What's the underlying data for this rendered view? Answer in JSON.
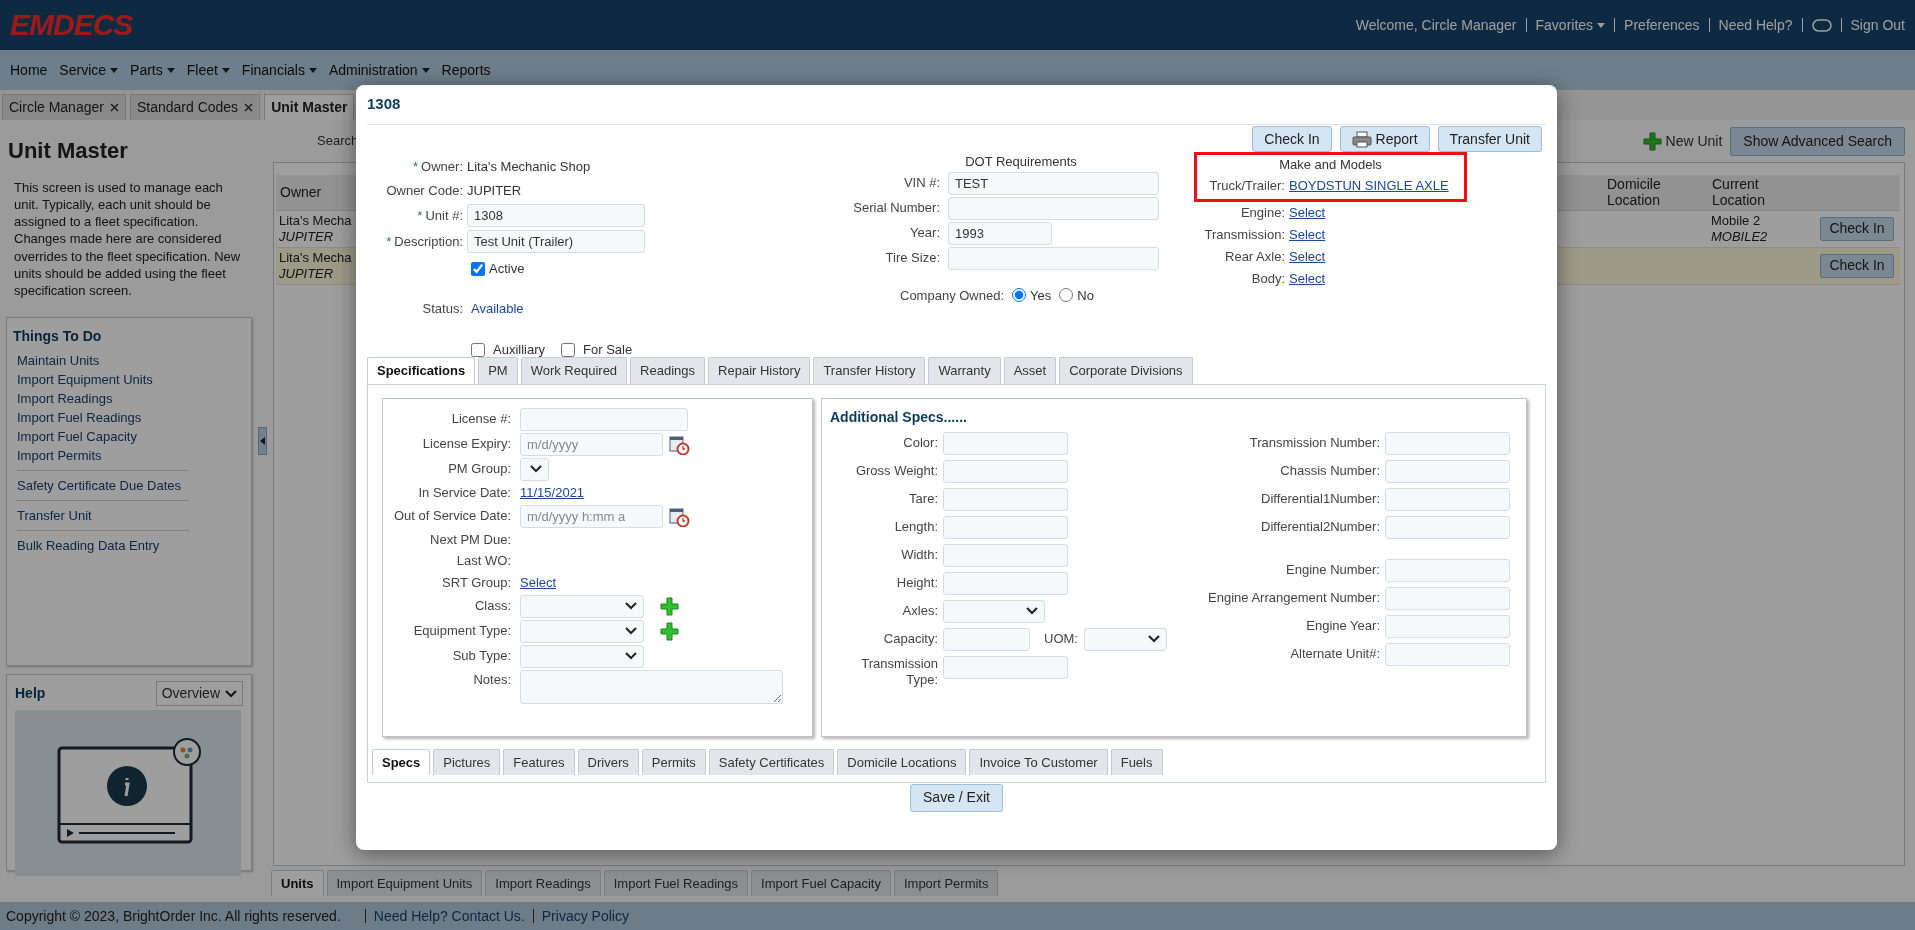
{
  "app": {
    "logo": "EMDECS"
  },
  "header_links": [
    {
      "kind": "text",
      "label": "Welcome, Circle Manager"
    },
    {
      "kind": "menu",
      "label": "Favorites"
    },
    {
      "kind": "link",
      "label": "Preferences"
    },
    {
      "kind": "link",
      "label": "Need Help?"
    },
    {
      "kind": "toggle"
    },
    {
      "kind": "link",
      "label": "Sign Out"
    }
  ],
  "menu": [
    {
      "label": "Home",
      "dropdown": false
    },
    {
      "label": "Service",
      "dropdown": true
    },
    {
      "label": "Parts",
      "dropdown": true
    },
    {
      "label": "Fleet",
      "dropdown": true
    },
    {
      "label": "Financials",
      "dropdown": true
    },
    {
      "label": "Administration",
      "dropdown": true
    },
    {
      "label": "Reports",
      "dropdown": false
    }
  ],
  "page_tabs": [
    {
      "label": "Circle Manager",
      "closable": true,
      "selected": false
    },
    {
      "label": "Standard Codes",
      "closable": true,
      "selected": false
    },
    {
      "label": "Unit Master",
      "closable": false,
      "selected": true
    }
  ],
  "sidebar": {
    "title": "Unit Master",
    "description": "This screen is used to manage each unit. Typically, each unit should be assigned to a fleet specification. Changes made here are considered overrides to the fleet specification. New units should be added using the fleet specification screen.",
    "todo": {
      "title": "Things To Do",
      "groups": [
        [
          "Maintain Units",
          "Import Equipment Units",
          "Import Readings",
          "Import Fuel Readings",
          "Import Fuel Capacity",
          "Import Permits"
        ],
        [
          "Safety Certificate Due Dates"
        ],
        [
          "Transfer Unit"
        ],
        [
          "Bulk Reading Data Entry"
        ]
      ]
    },
    "help": {
      "title": "Help",
      "dropdown": "Overview"
    }
  },
  "main": {
    "search_label": "Search",
    "new_unit": "New Unit",
    "advanced_search": "Show Advanced Search",
    "table": {
      "columns": [
        "Owner",
        "Domicile Location",
        "Current Location"
      ],
      "rows": [
        {
          "owner": "Lita's Mecha",
          "owner_code": "JUPITER",
          "location": "Mobile 2",
          "location_code": "MOBILE2",
          "action": "Check In",
          "selected": false
        },
        {
          "owner": "Lita's Mecha",
          "owner_code": "JUPITER",
          "action": "Check In",
          "selected": true
        }
      ]
    },
    "bottom_tabs": [
      {
        "label": "Units",
        "selected": true
      },
      {
        "label": "Import Equipment Units",
        "selected": false
      },
      {
        "label": "Import Readings",
        "selected": false
      },
      {
        "label": "Import Fuel Readings",
        "selected": false
      },
      {
        "label": "Import Fuel Capacity",
        "selected": false
      },
      {
        "label": "Import Permits",
        "selected": false
      }
    ]
  },
  "modal": {
    "title": "1308",
    "actions": [
      {
        "kind": "plain",
        "label": "Check In"
      },
      {
        "kind": "with-icon",
        "label": "Report"
      },
      {
        "kind": "plain",
        "label": "Transfer Unit"
      }
    ],
    "general": [
      {
        "marker": "*",
        "label": "Owner:",
        "kind": "static",
        "value": "Lita's Mechanic Shop"
      },
      {
        "label": "Owner Code:",
        "kind": "static",
        "value": "JUPITER"
      },
      {
        "marker": "*",
        "label": "Unit #:",
        "kind": "input",
        "value": "1308"
      },
      {
        "marker": "*",
        "label": "Description:",
        "kind": "input",
        "value": "Test Unit (Trailer)"
      }
    ],
    "active": {
      "label": "Active",
      "checked": true
    },
    "status": {
      "label": "Status:",
      "value": "Available"
    },
    "flags": [
      {
        "label": "Auxilliary",
        "checked": false
      },
      {
        "label": "For Sale",
        "checked": false
      }
    ],
    "dot": {
      "title": "DOT Requirements",
      "fields": [
        {
          "kind": "long",
          "label": "VIN #:",
          "value": "TEST"
        },
        {
          "kind": "long",
          "label": "Serial Number:"
        },
        {
          "kind": "short",
          "label": "Year:",
          "value": "1993"
        },
        {
          "kind": "long",
          "label": "Tire Size:"
        }
      ],
      "company_owned": {
        "label": "Company Owned:",
        "options": [
          {
            "label": "Yes",
            "selected": true
          },
          {
            "label": "No",
            "selected": false
          }
        ]
      }
    },
    "make_models": {
      "title": "Make and Models",
      "highlighted": true,
      "rows": [
        {
          "label": "Truck/Trailer:",
          "value": "BOYDSTUN SINGLE AXLE"
        },
        {
          "label": "Engine:",
          "value": "Select"
        },
        {
          "label": "Transmission:",
          "value": "Select"
        },
        {
          "label": "Rear Axle:",
          "value": "Select"
        },
        {
          "label": "Body:",
          "value": "Select"
        }
      ]
    },
    "tabs": [
      {
        "label": "Specifications",
        "selected": true
      },
      {
        "label": "PM",
        "selected": false
      },
      {
        "label": "Work Required",
        "selected": false
      },
      {
        "label": "Readings",
        "selected": false
      },
      {
        "label": "Repair History",
        "selected": false
      },
      {
        "label": "Transfer History",
        "selected": false
      },
      {
        "label": "Warranty",
        "selected": false
      },
      {
        "label": "Asset",
        "selected": false
      },
      {
        "label": "Corporate Divisions",
        "selected": false
      }
    ],
    "spec_fields": [
      {
        "label": "License #:",
        "kind": "input"
      },
      {
        "label": "License Expiry:",
        "kind": "date",
        "placeholder": "m/d/yyyy"
      },
      {
        "label": "PM Group:",
        "kind": "select-small"
      },
      {
        "label": "In Service Date:",
        "kind": "link",
        "value": "11/15/2021"
      },
      {
        "label": "Out of Service Date:",
        "kind": "date",
        "placeholder": "m/d/yyyy h:mm a"
      },
      {
        "label": "Next PM Due:",
        "kind": "static"
      },
      {
        "label": "Last WO:",
        "kind": "static"
      },
      {
        "label": "SRT Group:",
        "kind": "link",
        "value": "Select"
      },
      {
        "label": "Class:",
        "kind": "select",
        "add": true
      },
      {
        "label": "Equipment Type:",
        "kind": "select",
        "add": true
      },
      {
        "label": "Sub Type:",
        "kind": "select",
        "add": false
      },
      {
        "label": "Notes:",
        "kind": "textarea"
      }
    ],
    "additional": {
      "title": "Additional Specs......",
      "left": [
        {
          "label": "Color:",
          "kind": "input"
        },
        {
          "label": "Gross Weight:",
          "kind": "input"
        },
        {
          "label": "Tare:",
          "kind": "input"
        },
        {
          "label": "Length:",
          "kind": "input"
        },
        {
          "label": "Width:",
          "kind": "input"
        },
        {
          "label": "Height:",
          "kind": "input"
        },
        {
          "label": "Axles:",
          "kind": "select"
        },
        {
          "label": "Capacity:",
          "kind": "capacity",
          "uom": "UOM:"
        },
        {
          "label": "Transmission Type:",
          "kind": "input"
        }
      ],
      "right": [
        [
          {
            "label": "Transmission Number:"
          },
          {
            "label": "Chassis Number:"
          },
          {
            "label": "Differential1Number:"
          },
          {
            "label": "Differential2Number:"
          }
        ],
        [
          {
            "label": "Engine Number:"
          },
          {
            "label": "Engine Arrangement Number:"
          },
          {
            "label": "Engine Year:"
          },
          {
            "label": "Alternate Unit#:"
          }
        ]
      ]
    },
    "subtabs": [
      {
        "label": "Specs",
        "selected": true
      },
      {
        "label": "Pictures",
        "selected": false
      },
      {
        "label": "Features",
        "selected": false
      },
      {
        "label": "Drivers",
        "selected": false
      },
      {
        "label": "Permits",
        "selected": false
      },
      {
        "label": "Safety Certificates",
        "selected": false
      },
      {
        "label": "Domicile Locations",
        "selected": false
      },
      {
        "label": "Invoice To Customer",
        "selected": false
      },
      {
        "label": "Fuels",
        "selected": false
      }
    ],
    "save": "Save / Exit"
  },
  "footer": {
    "copyright": "Copyright © 2023, BrightOrder Inc. All rights reserved.",
    "links": [
      "Need Help? Contact Us.",
      "Privacy Policy"
    ]
  }
}
